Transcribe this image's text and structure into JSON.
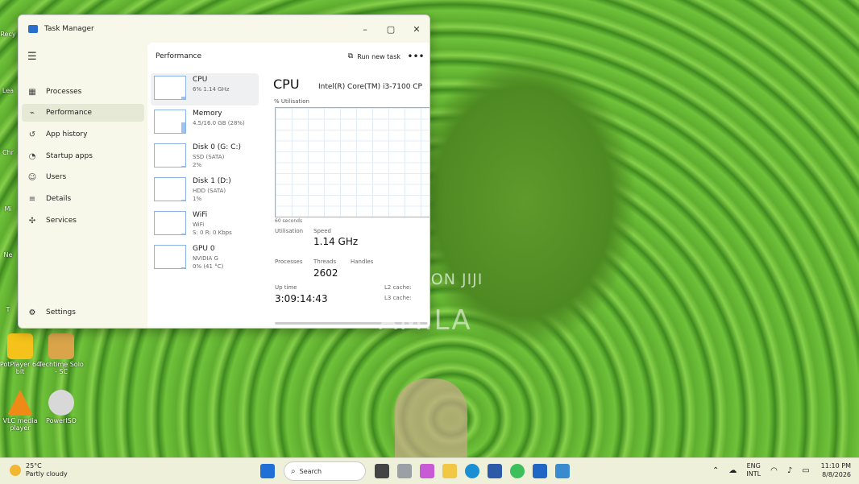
{
  "desktop": {
    "icons": [
      {
        "label": "PotPlayer 64 bit",
        "color": "#f4c21a"
      },
      {
        "label": "Techtime Solo - SC",
        "color": "#d9a44a"
      },
      {
        "label": "VLC media player",
        "color": "#f08a16"
      },
      {
        "label": "PowerISO",
        "color": "#d8d8d8"
      }
    ],
    "left_edge_labels": [
      "Recy",
      "Lea",
      "Chr",
      "Mi",
      "Ne",
      "T"
    ]
  },
  "window": {
    "title": "Task Manager",
    "controls": {
      "minimize": "–",
      "maximize": "▢",
      "close": "✕"
    }
  },
  "sidebar": {
    "items": [
      {
        "label": "Processes",
        "icon": "grid-icon",
        "glyph": "▦"
      },
      {
        "label": "Performance",
        "icon": "pulse-icon",
        "glyph": "⌁",
        "active": true
      },
      {
        "label": "App history",
        "icon": "history-icon",
        "glyph": "↺"
      },
      {
        "label": "Startup apps",
        "icon": "speedometer-icon",
        "glyph": "◔"
      },
      {
        "label": "Users",
        "icon": "users-icon",
        "glyph": "☺"
      },
      {
        "label": "Details",
        "icon": "list-icon",
        "glyph": "≡"
      },
      {
        "label": "Services",
        "icon": "puzzle-icon",
        "glyph": "✣"
      }
    ],
    "settings": "Settings"
  },
  "main": {
    "header": "Performance",
    "run_new_task": "Run new task",
    "more": "•••"
  },
  "devices": [
    {
      "name": "CPU",
      "sub1": "6% 1.14 GHz",
      "sub2": "",
      "level": 0.06
    },
    {
      "name": "Memory",
      "sub1": "4.5/16.0 GB (28%)",
      "sub2": "",
      "level": 0.28
    },
    {
      "name": "Disk 0 (G: C:)",
      "sub1": "SSD (SATA)",
      "sub2": "2%",
      "level": 0.02
    },
    {
      "name": "Disk 1 (D:)",
      "sub1": "HDD (SATA)",
      "sub2": "1%",
      "level": 0.01
    },
    {
      "name": "WiFi",
      "sub1": "WiFi",
      "sub2": "S: 0 R: 0 Kbps",
      "level": 0
    },
    {
      "name": "GPU 0",
      "sub1": "NVIDIA G",
      "sub2": "0% (41 °C)",
      "level": 0
    }
  ],
  "detail": {
    "title": "CPU",
    "model": "Intel(R) Core(TM) i3-7100 CP",
    "utilisation_label": "% Utilisation",
    "seconds_label": "60 seconds",
    "utilisation_label2": "Utilisation",
    "speed_label": "Speed",
    "speed_value": "1.14 GHz",
    "threads_label": "Threads",
    "handles_label": "Handles",
    "processes_label": "Processes",
    "threads_value": "2602",
    "uptime_label": "Up time",
    "uptime_value": "3:09:14:43",
    "l2_label": "L2 cache:",
    "l3_label": "L3 cache:"
  },
  "watermark": {
    "line1": "POSTED ON JIJI",
    "line2": "AMILA"
  },
  "taskbar": {
    "weather_temp": "25°C",
    "weather_desc": "Partly cloudy",
    "search": "Search",
    "lang1": "ENG",
    "lang2": "INTL",
    "time": "11:10 PM",
    "date": "8/8/2026"
  }
}
